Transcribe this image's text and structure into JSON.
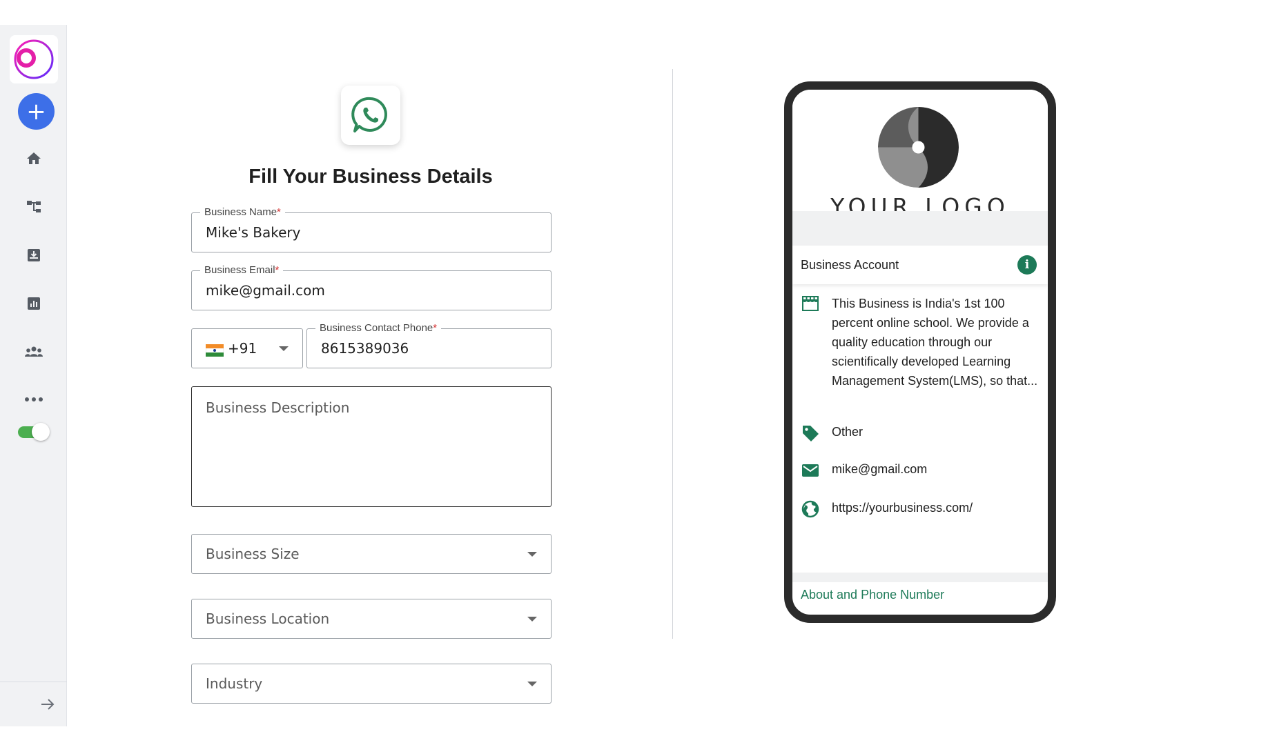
{
  "sidebar": {
    "brand_icon": "brand-logo-icon",
    "add_icon": "plus-icon",
    "add_symbol": "+",
    "items": [
      {
        "name": "home",
        "icon": "home-icon"
      },
      {
        "name": "flows",
        "icon": "flow-icon"
      },
      {
        "name": "inbox",
        "icon": "inbox-download-icon"
      },
      {
        "name": "analytics",
        "icon": "chart-icon"
      },
      {
        "name": "contacts",
        "icon": "people-icon"
      },
      {
        "name": "more",
        "icon": "more-dots-icon"
      }
    ],
    "toggle_on": true,
    "expand_icon": "arrow-right-icon"
  },
  "form": {
    "header_icon": "whatsapp-icon",
    "title": "Fill Your Business Details",
    "business_name": {
      "label": "Business Name",
      "required_mark": "*",
      "value": "Mike's Bakery"
    },
    "business_email": {
      "label": "Business Email",
      "required_mark": "*",
      "value": "mike@gmail.com"
    },
    "country_code": {
      "flag_icon": "india-flag-icon",
      "value": "+91"
    },
    "contact_phone": {
      "label": "Business Contact Phone",
      "required_mark": "*",
      "value": "8615389036"
    },
    "description": {
      "placeholder": "Business Description"
    },
    "business_size": {
      "placeholder": "Business Size"
    },
    "business_location": {
      "placeholder": "Business Location"
    },
    "industry": {
      "placeholder": "Industry"
    }
  },
  "preview": {
    "logo_text": "YOUR LOGO",
    "account_label": "Business Account",
    "info_symbol": "i",
    "description": "This Business is India's 1st 100 percent online school. We provide a quality education through our scientifically developed Learning Management System(LMS), so that...",
    "category": "Other",
    "email": "mike@gmail.com",
    "website": "https://yourbusiness.com/",
    "about_link": "About and Phone Number"
  },
  "colors": {
    "accent_blue": "#3d6fe8",
    "whatsapp_green": "#1d7a58",
    "toggle_green": "#4caf50",
    "required_red": "#d32f2f"
  }
}
